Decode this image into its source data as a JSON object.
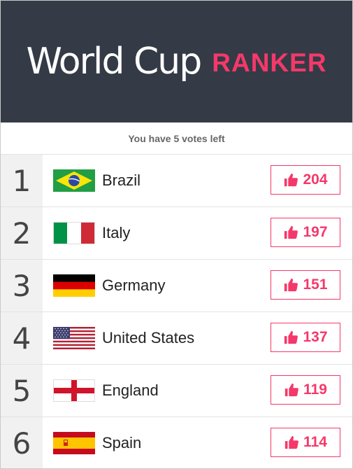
{
  "header": {
    "title_main": "World Cup",
    "title_accent": "RANKER"
  },
  "votes_left_text": "You have 5 votes left",
  "colors": {
    "header_bg": "#343b46",
    "accent": "#f5386a",
    "rank_bg": "#f1f1f1"
  },
  "rows": [
    {
      "rank": "1",
      "country": "Brazil",
      "votes": "204",
      "flag": "brazil-flag-icon"
    },
    {
      "rank": "2",
      "country": "Italy",
      "votes": "197",
      "flag": "italy-flag-icon"
    },
    {
      "rank": "3",
      "country": "Germany",
      "votes": "151",
      "flag": "germany-flag-icon"
    },
    {
      "rank": "4",
      "country": "United States",
      "votes": "137",
      "flag": "usa-flag-icon"
    },
    {
      "rank": "5",
      "country": "England",
      "votes": "119",
      "flag": "england-flag-icon"
    },
    {
      "rank": "6",
      "country": "Spain",
      "votes": "114",
      "flag": "spain-flag-icon"
    }
  ]
}
